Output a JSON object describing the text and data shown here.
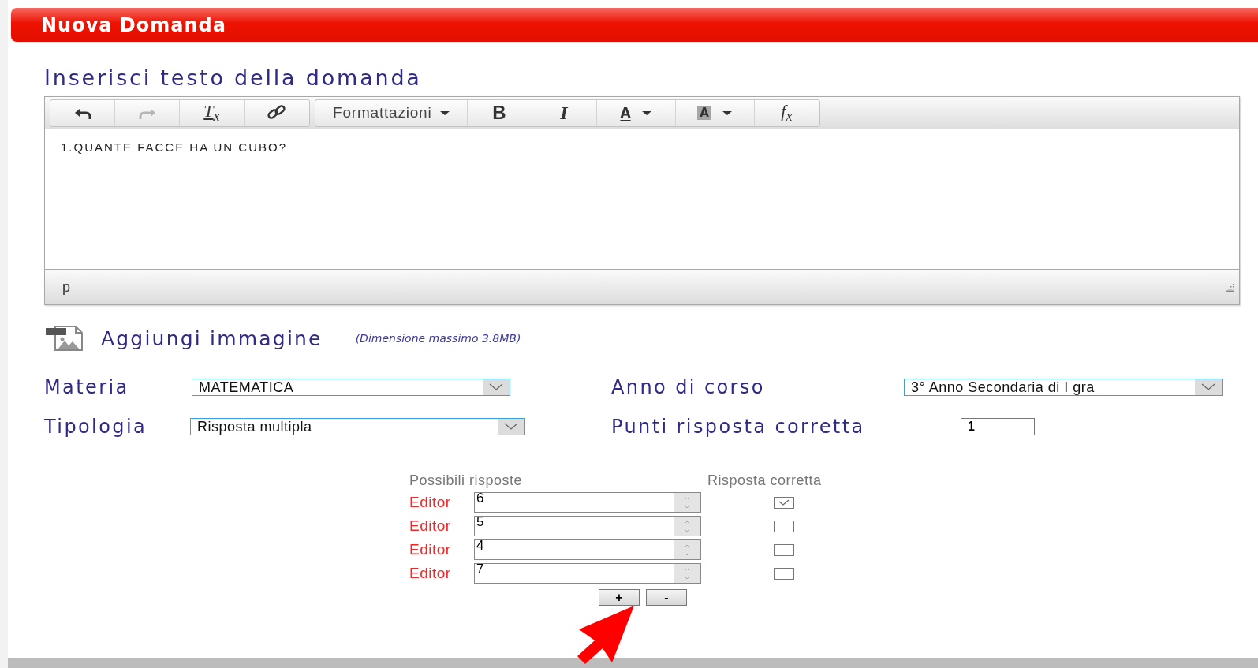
{
  "header": {
    "title": "Nuova Domanda"
  },
  "editor": {
    "heading": "Inserisci testo della domanda",
    "toolbar": [
      [
        {
          "kind": "undo",
          "disabled": false
        },
        {
          "kind": "redo",
          "disabled": true
        },
        {
          "kind": "clearformat",
          "label": "T$_{x}$",
          "disabled": false
        },
        {
          "kind": "link",
          "disabled": false
        }
      ],
      [
        {
          "kind": "menu",
          "label": "Formattazioni",
          "disabled": false
        },
        {
          "kind": "bold",
          "label": "B",
          "disabled": false
        },
        {
          "kind": "italic",
          "label": "I",
          "disabled": false
        },
        {
          "kind": "textcolor",
          "label": "A",
          "disabled": false
        },
        {
          "kind": "bgcolor",
          "label": "A",
          "disabled": false
        },
        {
          "kind": "formula",
          "label": "f$_{x}$",
          "disabled": false
        }
      ]
    ],
    "content": "1.QUANTE FACCE HA UN CUBO?",
    "path": "p"
  },
  "image": {
    "label": "Aggiungi immagine",
    "note": "(Dimensione massimo 3.8MB)"
  },
  "fields": [
    {
      "label": "Materia",
      "kind": "select",
      "value": "MATEMATICA"
    },
    {
      "label": "Anno di corso",
      "kind": "select",
      "value": "3° Anno Secondaria di I gra"
    },
    {
      "label": "Tipologia",
      "kind": "select",
      "value": "Risposta multipla"
    },
    {
      "label": "Punti risposta corretta",
      "kind": "input",
      "value": "1"
    }
  ],
  "answers": {
    "headers": [
      "Possibili risposte",
      "Risposta corretta"
    ],
    "rows": [
      {
        "link": "Editor",
        "value": "6",
        "correct": true
      },
      {
        "link": "Editor",
        "value": "5",
        "correct": false
      },
      {
        "link": "Editor",
        "value": "4",
        "correct": false
      },
      {
        "link": "Editor",
        "value": "7",
        "correct": false
      }
    ],
    "buttons": [
      "+",
      "-"
    ]
  }
}
